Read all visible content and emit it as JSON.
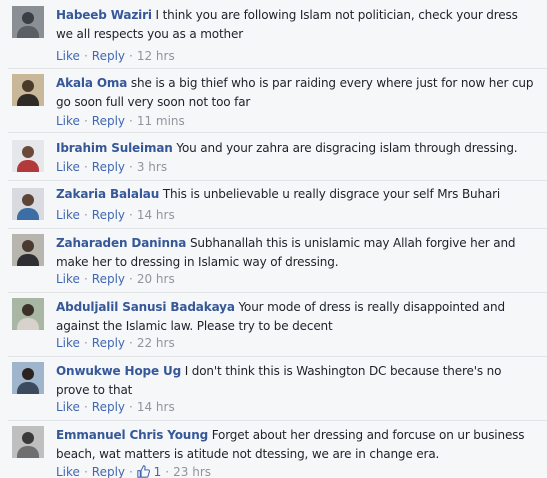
{
  "labels": {
    "like": "Like",
    "reply": "Reply",
    "sep": "·"
  },
  "comments": [
    {
      "author": "Habeeb Waziri",
      "text": "I think you are following Islam not politician, check your dress we all respects you as a mother",
      "time": "12 hrs",
      "avatar_colors": [
        "#8a8f96",
        "#3b3f45",
        "#5a5f66"
      ]
    },
    {
      "author": "Akala Oma",
      "text": "she is a big thief who is par raiding every where just for now her cup go soon full very soon not too far",
      "time": "11 mins",
      "avatar_colors": [
        "#c9b79a",
        "#4a3a2a",
        "#2f2a26"
      ]
    },
    {
      "author": "Ibrahim Suleiman",
      "text": "You and your zahra are disgracing islam through dressing.",
      "time": "3 hrs",
      "avatar_colors": [
        "#e5e7ea",
        "#6b4a3a",
        "#b33a3a"
      ]
    },
    {
      "author": "Zakaria Balalau",
      "text": "This is unbelievable u really disgrace your self Mrs Buhari",
      "time": "14 hrs",
      "avatar_colors": [
        "#d9dadf",
        "#5c4436",
        "#3a6ea5"
      ]
    },
    {
      "author": "Zaharaden Daninna",
      "text": "Subhanallah this is unislamic may Allah forgive her and make her to dressing in Islamic way of dressing.",
      "time": "20 hrs",
      "avatar_colors": [
        "#b8b4ae",
        "#4a3a30",
        "#2e2e33"
      ]
    },
    {
      "author": "Abduljalil Sanusi Badakaya",
      "text": "Your mode of dress is really disappointed and against the Islamic law. Please try to be decent",
      "time": "22 hrs",
      "avatar_colors": [
        "#a7b7a4",
        "#3c3128",
        "#d7d3cc"
      ]
    },
    {
      "author": "Onwukwe Hope Ug",
      "text": "I don't think this is Washington DC because there's no prove to that",
      "time": "14 hrs",
      "avatar_colors": [
        "#9fb5cc",
        "#2b231f",
        "#3b4a5c"
      ]
    },
    {
      "author": "Emmanuel Chris Young",
      "text": "Forget about her dressing and forcuse on ur business beach, wat matters is atitude not dtessing, we are in change era.",
      "time": "23 hrs",
      "like_count": "1",
      "avatar_colors": [
        "#bfbfbf",
        "#3a3a3a",
        "#6f6f6f"
      ]
    }
  ]
}
